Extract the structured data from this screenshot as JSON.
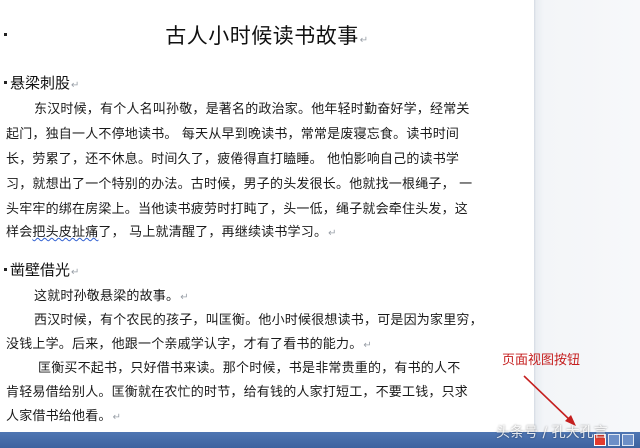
{
  "document": {
    "title": "古人小时候读书故事",
    "para_mark": "↵",
    "sections": [
      {
        "heading": "悬梁刺股",
        "lines": [
          "东汉时候，有个人名叫孙敬，是著名的政治家。他年轻时勤奋好学，经常关",
          "起门，独自一人不停地读书。 每天从早到晚读书，常常是废寝忘食。读书时间",
          "长，劳累了，还不休息。时间久了，疲倦得直打瞌睡。 他怕影响自己的读书学",
          "习，就想出了一个特别的办法。古时候，男子的头发很长。他就找一根绳子， 一",
          "头牢牢的绑在房梁上。当他读书疲劳时打盹了，头一低，绳子就会牵住头发，这",
          "样会",
          "把头皮扯痛",
          "了， 马上就清醒了，再继续读书学习。"
        ]
      },
      {
        "heading": "凿壁借光",
        "lines": [
          "这就时孙敬悬梁的故事。",
          "西汉时候，有个农民的孩子，叫匡衡。他小时候很想读书，可是因为家里穷，",
          "没钱上学。后来，他跟一个亲戚学认字，才有了看书的能力。",
          "匡衡买不起书，只好借书来读。那个时候，书是非常贵重的，有书的人不",
          "肯轻易借给别人。匡衡就在农忙的时节，给有钱的人家打短工，不要工钱，只求",
          "人家借书给他看。"
        ]
      }
    ]
  },
  "annotation": {
    "label": "页面视图按钮",
    "color": "#c51f1f"
  },
  "watermark": "头条号 / 孔大孔言",
  "status_bar": {
    "color": "#4469a8",
    "active_view_color": "#e23b2e"
  }
}
